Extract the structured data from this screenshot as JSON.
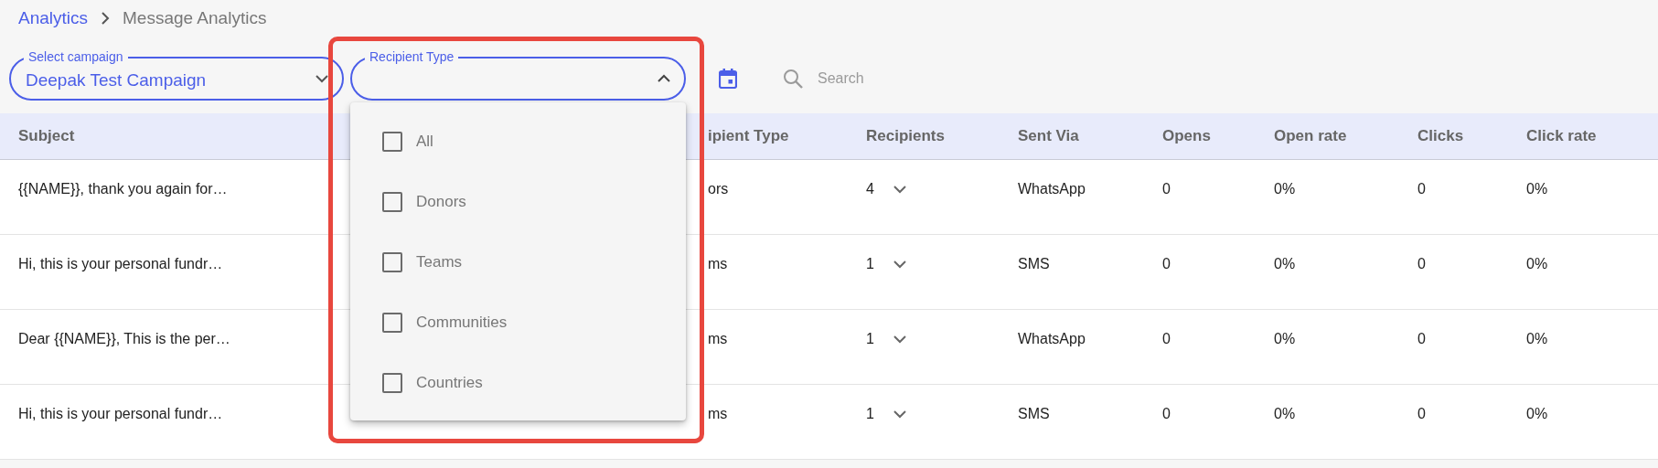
{
  "breadcrumb": [
    {
      "label": "Analytics",
      "kind": "link"
    },
    {
      "label": "Message Analytics",
      "kind": "current"
    }
  ],
  "filters": {
    "campaign": {
      "label": "Select campaign",
      "value": "Deepak Test Campaign"
    },
    "recipient_type": {
      "label": "Recipient Type",
      "expanded": true,
      "highlighted": true,
      "options": [
        {
          "label": "All",
          "checked": false
        },
        {
          "label": "Donors",
          "checked": false
        },
        {
          "label": "Teams",
          "checked": false
        },
        {
          "label": "Communities",
          "checked": false
        },
        {
          "label": "Countries",
          "checked": false
        }
      ]
    },
    "search": {
      "placeholder": "Search"
    }
  },
  "table": {
    "columns": [
      "Subject",
      "ipient Type",
      "Recipients",
      "Sent Via",
      "Opens",
      "Open rate",
      "Clicks",
      "Click rate"
    ],
    "rows": [
      {
        "cells": [
          "{{NAME}}, thank you again for…",
          "ors",
          "4",
          "WhatsApp",
          "0",
          "0%",
          "0",
          "0%"
        ]
      },
      {
        "cells": [
          "Hi, this is your personal fundr…",
          "ms",
          "1",
          "SMS",
          "0",
          "0%",
          "0",
          "0%"
        ]
      },
      {
        "cells": [
          "Dear {{NAME}}, This is the per…",
          "ms",
          "1",
          "WhatsApp",
          "0",
          "0%",
          "0",
          "0%"
        ]
      },
      {
        "cells": [
          "Hi, this is your personal fundr…",
          "ms",
          "1",
          "SMS",
          "0",
          "0%",
          "0",
          "0%"
        ]
      }
    ]
  }
}
